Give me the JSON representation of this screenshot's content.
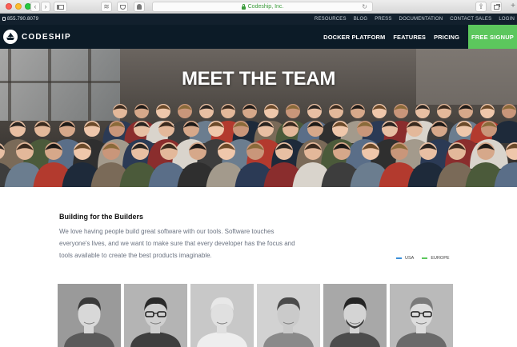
{
  "browser": {
    "url_text": "Codeship, Inc."
  },
  "utility_bar": {
    "phone": "855.790.8079",
    "links": [
      "RESOURCES",
      "BLOG",
      "PRESS",
      "DOCUMENTATION",
      "CONTACT SALES",
      "LOGIN"
    ]
  },
  "nav": {
    "logo_text": "CODESHIP",
    "links": [
      "DOCKER PLATFORM",
      "FEATURES",
      "PRICING"
    ],
    "signup_label": "FREE SIGNUP",
    "signup_color": "#5cc75d"
  },
  "hero": {
    "title": "MEET THE TEAM"
  },
  "intro": {
    "heading": "Building for the Builders",
    "body": "We love having people build great software with our tools. Software touches everyone's lives, and we want to make sure that every developer has the focus and tools available to create the best products imaginable."
  },
  "legend": {
    "items": [
      {
        "label": "USA",
        "color": "#3b8fd9"
      },
      {
        "label": "EUROPE",
        "color": "#5cc75d"
      }
    ]
  },
  "team": {
    "member_count_visible": 6
  }
}
